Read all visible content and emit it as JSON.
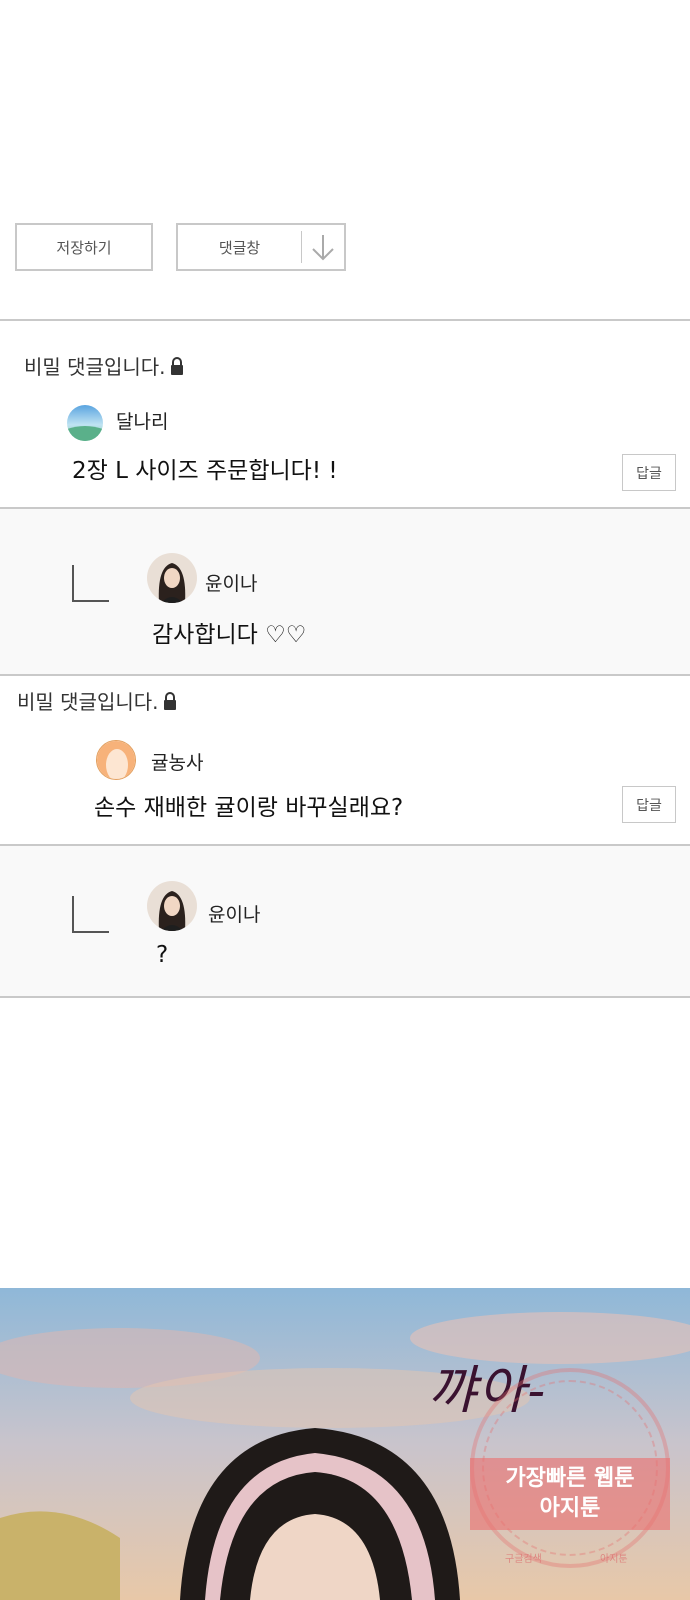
{
  "toolbar": {
    "save_label": "저장하기",
    "comments_label": "댓글창"
  },
  "comments": [
    {
      "secret_label": "비밀 댓글입니다.",
      "nickname": "달나리",
      "text": "2장 L 사이즈 주문합니다! !",
      "reply_label": "답글"
    },
    {
      "nickname": "윤이나",
      "text": "감사합니다 ♡♡"
    },
    {
      "secret_label": "비밀 댓글입니다.",
      "nickname": "귤농사",
      "text": "손수 재배한 귤이랑 바꾸실래요?",
      "reply_label": "답글"
    },
    {
      "nickname": "윤이나",
      "text": "?"
    }
  ],
  "artwork": {
    "title": "꺄아-",
    "watermark_line1": "가장빠른 웹툰",
    "watermark_line2": "아지툰",
    "watermark_small_left": "구글검색",
    "watermark_small_right": "아지툰",
    "sky_top": "#8fb8d8",
    "sky_mid": "#e8c8a8"
  }
}
